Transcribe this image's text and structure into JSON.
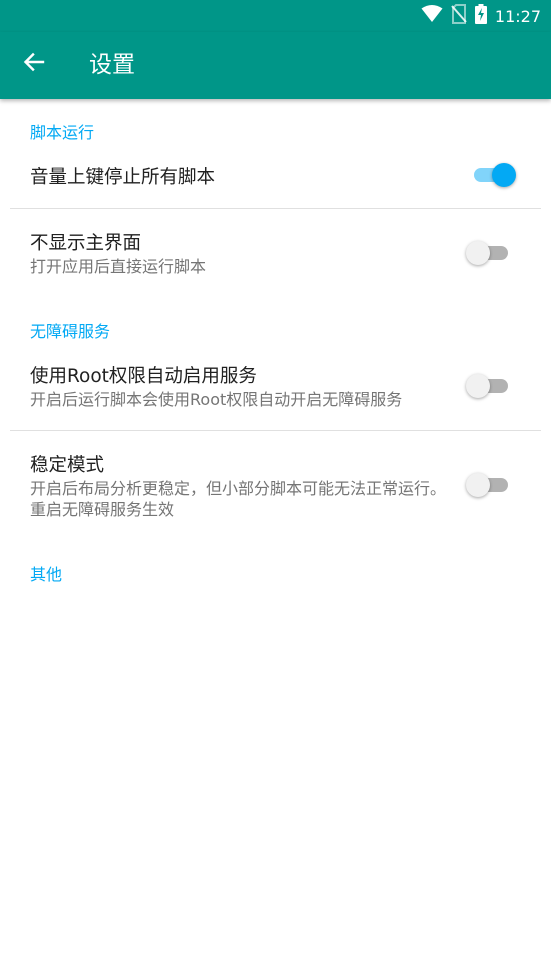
{
  "status_bar": {
    "time": "11:27",
    "icons": [
      "wifi-icon",
      "no-sim-icon",
      "battery-charging-icon"
    ]
  },
  "app_bar": {
    "title": "设置",
    "back_icon": "arrow-back-icon"
  },
  "sections": [
    {
      "header": "脚本运行",
      "items": [
        {
          "title": "音量上键停止所有脚本",
          "summary": "",
          "checked": true
        },
        {
          "title": "不显示主界面",
          "summary": "打开应用后直接运行脚本",
          "checked": false
        }
      ]
    },
    {
      "header": "无障碍服务",
      "items": [
        {
          "title": "使用Root权限自动启用服务",
          "summary": "开启后运行脚本会使用Root权限自动开启无障碍服务",
          "checked": false
        },
        {
          "title": "稳定模式",
          "summary": "开启后布局分析更稳定，但小部分脚本可能无法正常运行。重启无障碍服务生效",
          "checked": false
        }
      ]
    },
    {
      "header": "其他",
      "items": []
    }
  ],
  "colors": {
    "primary": "#009688",
    "accent": "#03a9f4",
    "switch_track_on": "#81d4fa",
    "switch_track_off": "#b2b2b2",
    "text_primary": "#212121",
    "text_secondary": "#757575"
  }
}
